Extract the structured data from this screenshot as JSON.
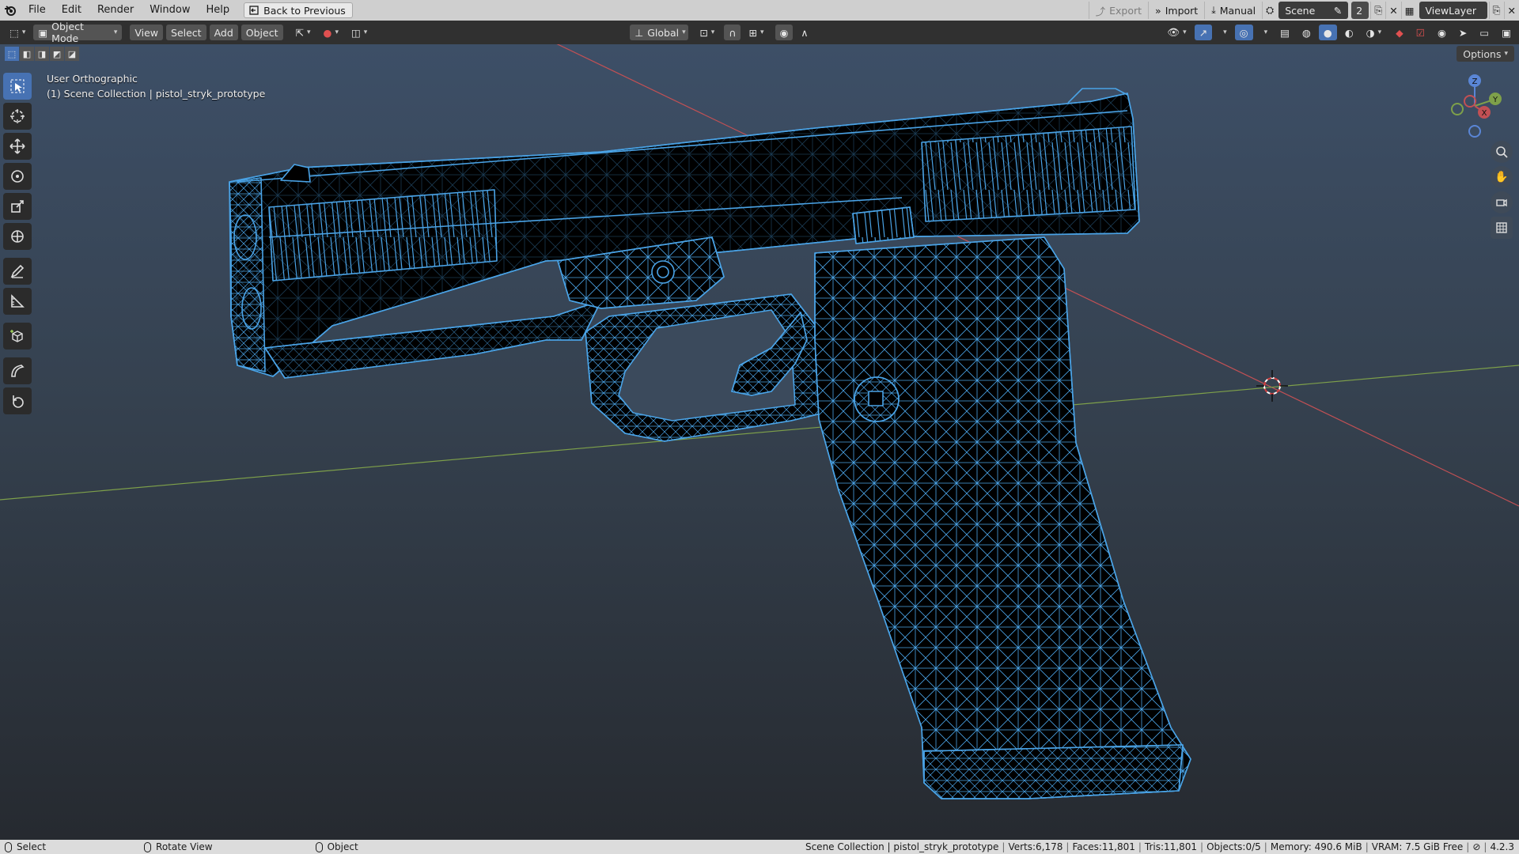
{
  "menubar": {
    "items": [
      "File",
      "Edit",
      "Render",
      "Window",
      "Help"
    ],
    "back_label": "Back to Previous",
    "export_label": "Export",
    "import_label": "Import",
    "manual_label": "Manual",
    "scene_label": "Scene",
    "scene_count": "2",
    "viewlayer_label": "ViewLayer"
  },
  "header": {
    "mode_label": "Object Mode",
    "view_label": "View",
    "select_label": "Select",
    "add_label": "Add",
    "object_label": "Object",
    "orientation_label": "Global"
  },
  "subrow": {
    "options_label": "Options"
  },
  "viewport": {
    "view_name": "User Orthographic",
    "collection_info": "(1) Scene Collection | pistol_stryk_prototype",
    "wire_color": "#4aa3e6",
    "x_axis_color": "#c25054",
    "y_axis_color": "#7ea04a"
  },
  "gizmo": {
    "x_label": "X",
    "y_label": "Y",
    "z_label": "Z"
  },
  "statusbar": {
    "select_label": "Select",
    "rotate_label": "Rotate View",
    "object_label": "Object",
    "stats": [
      "Scene Collection | pistol_stryk_prototype",
      "Verts:6,178",
      "Faces:11,801",
      "Tris:11,801",
      "Objects:0/5",
      "Memory: 490.6 MiB",
      "VRAM: 7.5 GiB Free"
    ],
    "version": "4.2.3"
  }
}
